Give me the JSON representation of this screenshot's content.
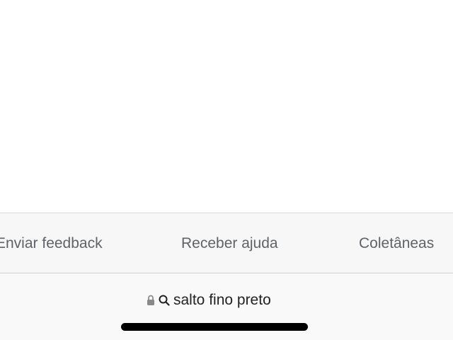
{
  "footer": {
    "links": [
      {
        "label": "Enviar feedback"
      },
      {
        "label": "Receber ajuda"
      },
      {
        "label": "Coletâneas"
      }
    ]
  },
  "address_bar": {
    "url_text": "salto fino preto",
    "secure_icon": "lock-icon",
    "search_icon": "search-icon"
  },
  "colors": {
    "link_text": "#5f6368",
    "url_text": "#222222",
    "footer_bg": "#f7f7f7",
    "home_indicator": "#000000"
  }
}
